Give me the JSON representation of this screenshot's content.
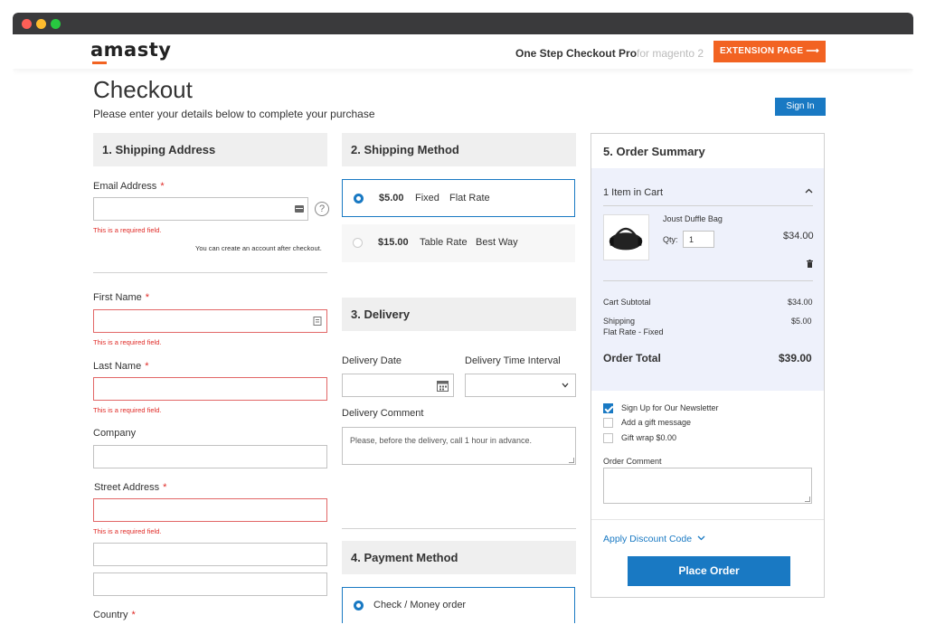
{
  "brand": {
    "logo": "amasty",
    "product": "One Step Checkout Pro",
    "platform": "for magento 2",
    "extension_button": "EXTENSION PAGE  ⟶"
  },
  "page": {
    "title": "Checkout",
    "subtitle": "Please enter your details below to complete your purchase",
    "sign_in": "Sign In"
  },
  "shipping_address": {
    "heading": "1. Shipping Address",
    "email_label": "Email Address",
    "required_mark": "*",
    "required_error": "This is a required field.",
    "account_hint": "You can create an account after checkout.",
    "first_name_label": "First Name",
    "last_name_label": "Last Name",
    "company_label": "Company",
    "street_label": "Street Address",
    "country_label": "Country",
    "help_icon": "?"
  },
  "shipping_method": {
    "heading": "2. Shipping Method",
    "options": [
      {
        "price": "$5.00",
        "method": "Fixed",
        "carrier": "Flat Rate"
      },
      {
        "price": "$15.00",
        "method": "Table Rate",
        "carrier": "Best Way"
      }
    ]
  },
  "delivery": {
    "heading": "3. Delivery",
    "date_label": "Delivery Date",
    "time_label": "Delivery Time Interval",
    "comment_label": "Delivery Comment",
    "comment_placeholder": "Please, before the delivery, call 1 hour in advance."
  },
  "payment": {
    "heading": "4. Payment Method",
    "option": "Check / Money order"
  },
  "summary": {
    "heading": "5. Order Summary",
    "items_in_cart": "1 Item in Cart",
    "item_name": "Joust Duffle Bag",
    "qty_label": "Qty:",
    "qty_value": "1",
    "item_price": "$34.00",
    "cart_subtotal_label": "Cart Subtotal",
    "cart_subtotal_value": "$34.00",
    "shipping_label": "Shipping",
    "shipping_value": "$5.00",
    "shipping_method": "Flat Rate - Fixed",
    "order_total_label": "Order Total",
    "order_total_value": "$39.00",
    "newsletter": "Sign Up for Our Newsletter",
    "gift_message": "Add a gift message",
    "gift_wrap": "Gift wrap $0.00",
    "order_comment_label": "Order Comment",
    "discount": "Apply Discount Code",
    "place_order": "Place Order"
  },
  "colors": {
    "accent": "#1979c3",
    "brand": "#f26322",
    "error": "#e02b27"
  }
}
